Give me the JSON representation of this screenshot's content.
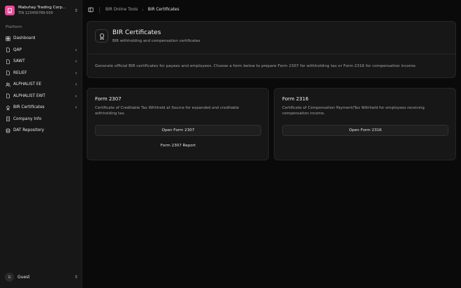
{
  "company": {
    "name": "Mabuhay Trading Corp...",
    "tin": "TIN 123456789-000",
    "icon": "building-icon"
  },
  "sidebar": {
    "section_label": "Platform",
    "items": [
      {
        "label": "Dashboard",
        "icon": "dashboard-icon",
        "chevron": false
      },
      {
        "label": "QAP",
        "icon": "file-icon",
        "chevron": true
      },
      {
        "label": "SAWT",
        "icon": "file-icon",
        "chevron": true
      },
      {
        "label": "RELIEF",
        "icon": "file-icon",
        "chevron": true
      },
      {
        "label": "ALPHALIST EE",
        "icon": "users-icon",
        "chevron": true
      },
      {
        "label": "ALPHALIST EWT",
        "icon": "file-icon",
        "chevron": true
      },
      {
        "label": "BIR Certificates",
        "icon": "award-icon",
        "chevron": true
      },
      {
        "label": "Company Info",
        "icon": "building-icon",
        "chevron": false
      },
      {
        "label": "DAT Repository",
        "icon": "database-icon",
        "chevron": false
      }
    ]
  },
  "user": {
    "initial": "G",
    "name": "Guest"
  },
  "breadcrumb": {
    "parent": "BIR Online Tools",
    "separator": "›",
    "current": "BIR Certificates"
  },
  "header": {
    "title": "BIR Certificates",
    "subtitle": "BIR withholding and compensation certificates",
    "description": "Generate official BIR certificates for payees and employees. Choose a form below to prepare Form 2307 for withholding tax or Form 2316 for compensation income."
  },
  "forms": [
    {
      "title": "Form 2307",
      "description": "Certificate of Creditable Tax Withheld at Source for expanded and creditable withholding tax.",
      "primary_button": "Open Form 2307",
      "secondary_button": "Form 2307 Report"
    },
    {
      "title": "Form 2316",
      "description": "Certificate of Compensation Payment/Tax Withheld for employees receiving compensation income.",
      "primary_button": "Open Form 2316"
    }
  ],
  "colors": {
    "accent": "#ec4899",
    "background": "#0a0a0a",
    "card": "#171717"
  }
}
